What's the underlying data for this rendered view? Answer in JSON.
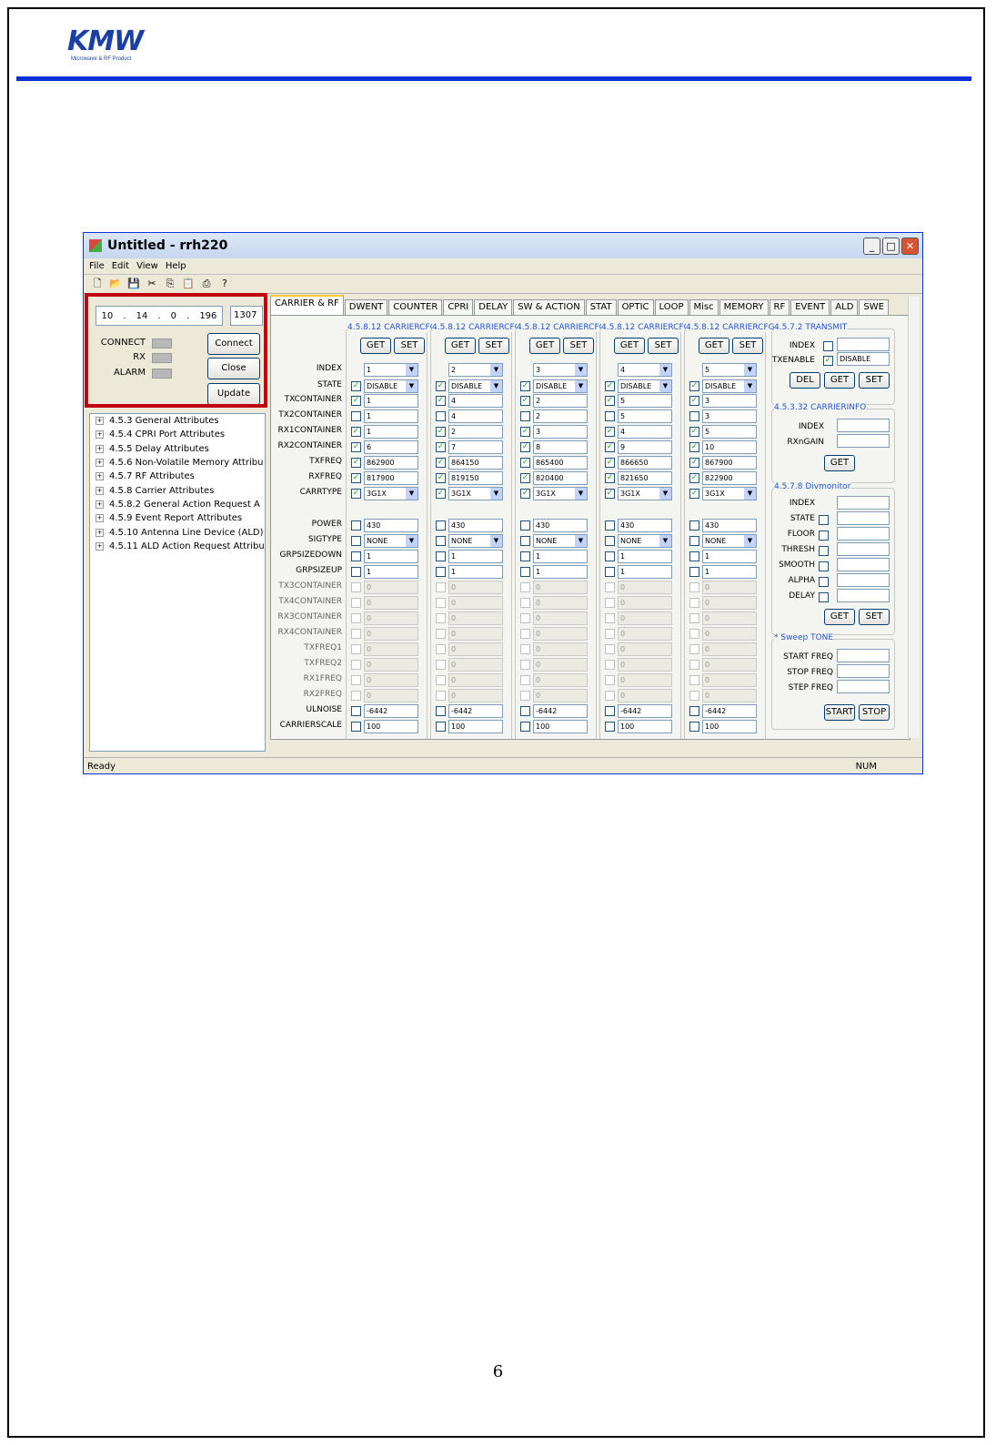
{
  "header": {
    "logo_text": "KMW",
    "logo_tagline": "Microwave & RF Product"
  },
  "page_number": "6",
  "window": {
    "title": "Untitled - rrh220",
    "menu": [
      "File",
      "Edit",
      "View",
      "Help"
    ],
    "connection": {
      "ip": [
        "10",
        "14",
        "0",
        "196"
      ],
      "port": "1307",
      "status_labels": [
        "CONNECT",
        "RX",
        "ALARM"
      ],
      "buttons": [
        "Connect",
        "Close",
        "Update"
      ]
    },
    "tree": [
      "4.5.3 General Attributes",
      "4.5.4 CPRI Port Attributes",
      "4.5.5 Delay Attributes",
      "4.5.6 Non-Volatile Memory Attribu",
      "4.5.7 RF Attributes",
      "4.5.8 Carrier Attributes",
      "4.5.8.2 General Action Request A",
      "4.5.9 Event Report Attributes",
      "4.5.10 Antenna Line Device (ALD)",
      "4.5.11 ALD Action Request Attribu"
    ],
    "tabs": [
      "CARRIER & RF",
      "DWENT",
      "COUNTER",
      "CPRI",
      "DELAY",
      "SW & ACTION",
      "STAT",
      "OPTIC",
      "LOOP",
      "Misc",
      "MEMORY",
      "RF",
      "EVENT",
      "ALD",
      "SWE"
    ],
    "carrier_groups_title": "4.5.8.12 CARRIERCFG",
    "get_label": "GET",
    "set_label": "SET",
    "row_labels": [
      "INDEX",
      "STATE",
      "TXCONTAINER",
      "TX2CONTAINER",
      "RX1CONTAINER",
      "RX2CONTAINER",
      "TXFREQ",
      "RXFREQ",
      "CARRTYPE",
      "POWER",
      "SIGTYPE",
      "GRPSIZEDOWN",
      "GRPSIZEUP",
      "TX3CONTAINER",
      "TX4CONTAINER",
      "RX3CONTAINER",
      "RX4CONTAINER",
      "TXFREQ1",
      "TXFREQ2",
      "RX1FREQ",
      "RX2FREQ",
      "ULNOISE",
      "CARRIERSCALE"
    ],
    "columns": [
      {
        "index": "1",
        "state": "DISABLE",
        "tx": "1",
        "tx2": "1",
        "rx1": "1",
        "rx2": "6",
        "txfreq": "862900",
        "rxfreq": "817900",
        "carrtype": "3G1X",
        "power": "430",
        "sigtype": "NONE",
        "gdown": "1",
        "gup": "1",
        "zero": "0",
        "ulnoise": "-6442",
        "scale": "100"
      },
      {
        "index": "2",
        "state": "DISABLE",
        "tx": "4",
        "tx2": "4",
        "rx1": "2",
        "rx2": "7",
        "txfreq": "864150",
        "rxfreq": "819150",
        "carrtype": "3G1X",
        "power": "430",
        "sigtype": "NONE",
        "gdown": "1",
        "gup": "1",
        "zero": "0",
        "ulnoise": "-6442",
        "scale": "100"
      },
      {
        "index": "3",
        "state": "DISABLE",
        "tx": "2",
        "tx2": "2",
        "rx1": "3",
        "rx2": "8",
        "txfreq": "865400",
        "rxfreq": "820400",
        "carrtype": "3G1X",
        "power": "430",
        "sigtype": "NONE",
        "gdown": "1",
        "gup": "1",
        "zero": "0",
        "ulnoise": "-6442",
        "scale": "100"
      },
      {
        "index": "4",
        "state": "DISABLE",
        "tx": "5",
        "tx2": "5",
        "rx1": "4",
        "rx2": "9",
        "txfreq": "866650",
        "rxfreq": "821650",
        "carrtype": "3G1X",
        "power": "430",
        "sigtype": "NONE",
        "gdown": "1",
        "gup": "1",
        "zero": "0",
        "ulnoise": "-6442",
        "scale": "100"
      },
      {
        "index": "5",
        "state": "DISABLE",
        "tx": "3",
        "tx2": "3",
        "rx1": "5",
        "rx2": "10",
        "txfreq": "867900",
        "rxfreq": "822900",
        "carrtype": "3G1X",
        "power": "430",
        "sigtype": "NONE",
        "gdown": "1",
        "gup": "1",
        "zero": "0",
        "ulnoise": "-6442",
        "scale": "100"
      }
    ],
    "transmit": {
      "title": "4.5.7.2 TRANSMIT",
      "index_label": "INDEX",
      "txenable_label": "TXENABLE",
      "txenable_value": "DISABLE",
      "buttons": [
        "DEL",
        "GET",
        "SET"
      ]
    },
    "carrierinfo": {
      "title": "4.5.3.32 CARRIERINFO",
      "labels": [
        "INDEX",
        "RXnGAIN"
      ],
      "button": "GET"
    },
    "divmonitor": {
      "title": "4.5.7.8 Divmonitor",
      "labels": [
        "INDEX",
        "STATE",
        "FLOOR",
        "THRESH",
        "SMOOTH",
        "ALPHA",
        "DELAY"
      ],
      "buttons": [
        "GET",
        "SET"
      ]
    },
    "sweep": {
      "title": "* Sweep TONE",
      "labels": [
        "START FREQ",
        "STOP FREQ",
        "STEP FREQ"
      ],
      "buttons": [
        "START",
        "STOP"
      ]
    },
    "status": {
      "left": "Ready",
      "right": "NUM"
    }
  }
}
